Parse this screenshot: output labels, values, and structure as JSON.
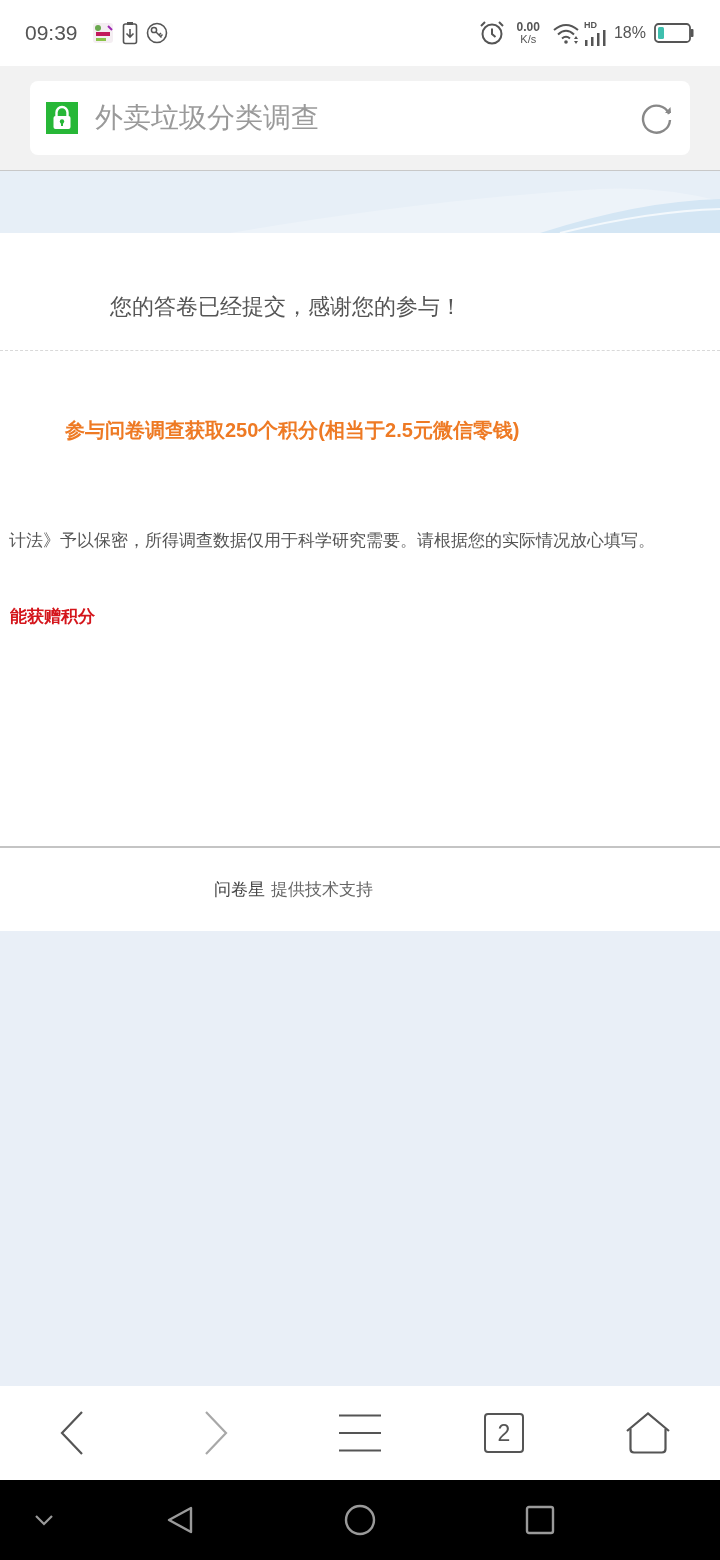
{
  "status_bar": {
    "time": "09:39",
    "net_speed": "0.00",
    "net_speed_unit": "K/s",
    "network_type": "HD",
    "battery": "18%"
  },
  "address_bar": {
    "title": "外卖垃圾分类调查"
  },
  "page": {
    "message": "您的答卷已经提交，感谢您的参与！",
    "reward": "参与问卷调查获取250个积分(相当于2.5元微信零钱)",
    "privacy_note": "计法》予以保密，所得调查数据仅用于科学研究需要。请根据您的实际情况放心填写。",
    "points_note": "能获赠积分"
  },
  "footer": {
    "brand": "问卷星",
    "credit": "提供技术支持"
  },
  "toolbar": {
    "buttons": [
      {
        "kind": "back",
        "disabled": false
      },
      {
        "kind": "forward",
        "disabled": true
      },
      {
        "kind": "menu",
        "disabled": false
      },
      {
        "kind": "tabs",
        "label": "2",
        "disabled": false
      },
      {
        "kind": "home",
        "disabled": false
      }
    ]
  },
  "nav_bar": {
    "buttons": [
      {
        "kind": "collapse"
      },
      {
        "kind": "back"
      },
      {
        "kind": "home"
      },
      {
        "kind": "recents"
      }
    ]
  }
}
